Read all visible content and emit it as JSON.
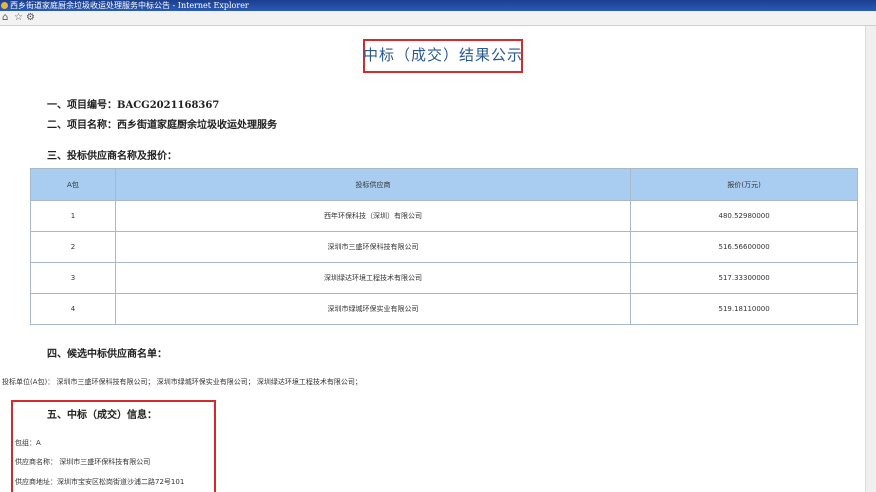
{
  "window": {
    "title": "西乡街道家庭厨余垃圾收运处理服务中标公告 - Internet Explorer"
  },
  "nav": {
    "home_icon": "⌂",
    "star_icon": "☆",
    "gear_icon": "⚙"
  },
  "page": {
    "title": "中标（成交）结果公示",
    "project_no": "一、项目编号：BACG2021168367",
    "project_name": "二、项目名称：西乡街道家庭厨余垃圾收运处理服务",
    "bidders_heading": "三、投标供应商名称及报价：",
    "table": {
      "headers": [
        "A包",
        "投标供应商",
        "报价(万元)"
      ],
      "rows": [
        [
          "1",
          "西年环保科技（深圳）有限公司",
          "480.52980000"
        ],
        [
          "2",
          "深圳市三盛环保科技有限公司",
          "516.56600000"
        ],
        [
          "3",
          "深圳绿达环境工程技术有限公司",
          "517.33300000"
        ],
        [
          "4",
          "深圳市绿城环保实业有限公司",
          "519.18110000"
        ]
      ]
    },
    "candidates_heading": "四、候选中标供应商名单：",
    "candidates_text": "投标单位(A包)： 深圳市三盛环保科技有限公司； 深圳市绿城环保实业有限公司； 深圳绿达环境工程技术有限公司；",
    "award_heading": "五、中标（成交）信息：",
    "award_package": "包组：A",
    "award_supplier": "供应商名称： 深圳市三盛环保科技有限公司",
    "award_address": "供应商地址：深圳市宝安区松岗街道沙浦二路72号101"
  }
}
